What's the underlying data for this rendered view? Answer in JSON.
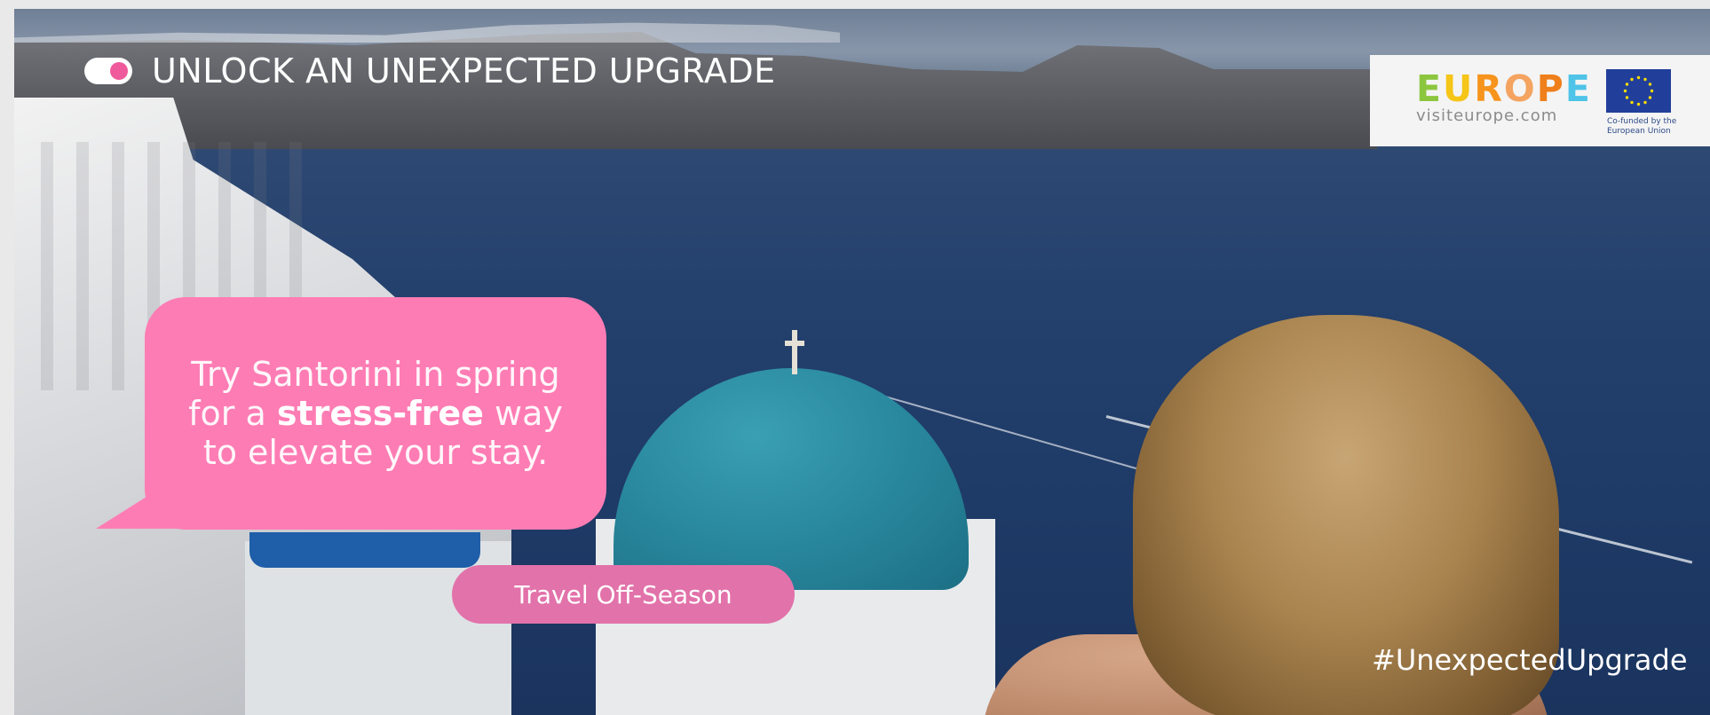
{
  "header": {
    "title": "UNLOCK AN UNEXPECTED UPGRADE",
    "toggle_state": "on"
  },
  "logo": {
    "brand_letters": [
      {
        "char": "E",
        "color": "#8cc63f"
      },
      {
        "char": "U",
        "color": "#f5c518"
      },
      {
        "char": "R",
        "color": "#f7941d"
      },
      {
        "char": "O",
        "color": "#f4a460"
      },
      {
        "char": "P",
        "color": "#ef7f1a"
      },
      {
        "char": "E",
        "color": "#4fc3e8"
      }
    ],
    "url": "visiteurope.com",
    "eu_caption_line1": "Co-funded by the",
    "eu_caption_line2": "European Union"
  },
  "bubble": {
    "line1": "Try Santorini in spring",
    "line2_prefix": "for a ",
    "line2_bold": "stress-free",
    "line2_suffix": " way",
    "line3": "to elevate your stay."
  },
  "cta": {
    "label": "Travel Off-Season"
  },
  "hashtag": "#UnexpectedUpgrade",
  "colors": {
    "accent_pink": "#fe7cb4",
    "button_pink": "#e272aa",
    "eu_blue": "#213f9a",
    "eu_star_yellow": "#ffdd00"
  }
}
